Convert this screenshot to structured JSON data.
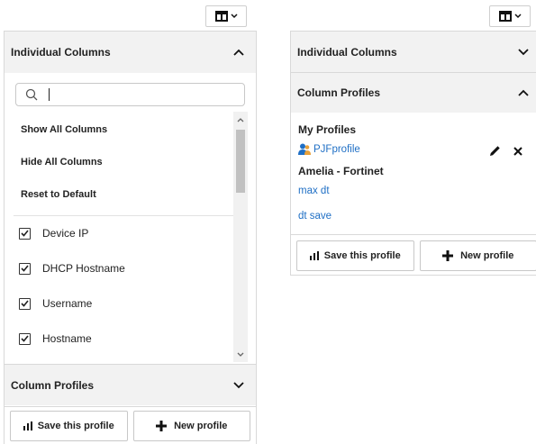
{
  "left_panel": {
    "individual_columns": {
      "title": "Individual Columns",
      "expanded": true
    },
    "search": {
      "value": "",
      "placeholder": ""
    },
    "actions": [
      "Show All Columns",
      "Hide All Columns",
      "Reset to Default"
    ],
    "columns": [
      {
        "label": "Device IP",
        "checked": true
      },
      {
        "label": "DHCP Hostname",
        "checked": true
      },
      {
        "label": "Username",
        "checked": true
      },
      {
        "label": "Hostname",
        "checked": true
      }
    ],
    "column_profiles": {
      "title": "Column Profiles",
      "expanded": false
    },
    "footer": {
      "save_label": "Save this profile",
      "new_label": "New profile"
    }
  },
  "right_panel": {
    "individual_columns": {
      "title": "Individual Columns",
      "expanded": false
    },
    "column_profiles": {
      "title": "Column Profiles",
      "expanded": true
    },
    "my_profiles_heading": "My Profiles",
    "my_profiles": [
      "PJFprofile"
    ],
    "shared_heading": "Amelia - Fortinet",
    "shared_profiles": [
      "max dt",
      "dt save"
    ],
    "footer": {
      "save_label": "Save this profile",
      "new_label": "New profile"
    }
  },
  "colors": {
    "link": "#1f6fc5",
    "header_bg": "#f2f2f2",
    "border": "#d9d9d9"
  },
  "icons": [
    "columns-icon",
    "chevron-down-icon",
    "chevron-up-icon",
    "search-icon",
    "checkbox-checked-icon",
    "bar-chart-icon",
    "plus-icon",
    "user-icon",
    "pencil-icon",
    "close-icon"
  ]
}
